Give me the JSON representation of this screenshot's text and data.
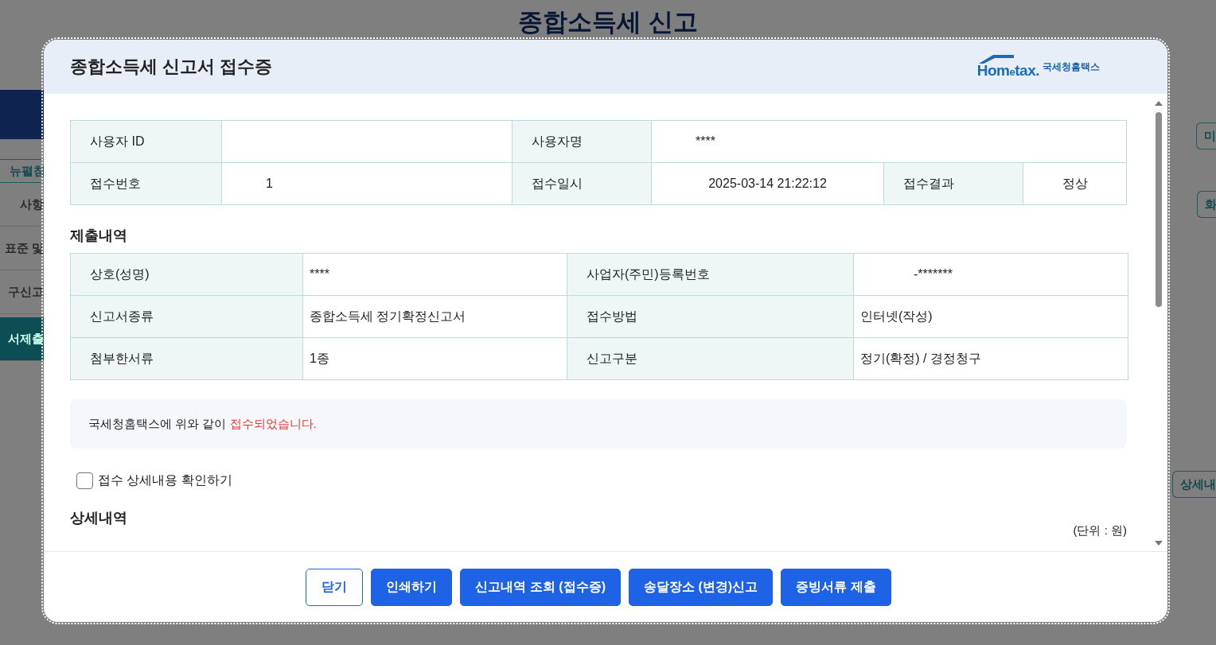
{
  "background_page": {
    "title": "종합소득세 신고",
    "menu_toggle": "뉴펼침",
    "sidebar": [
      {
        "label": "사항",
        "selected": false
      },
      {
        "label": "표준 및",
        "selected": false
      },
      {
        "label": "구신고",
        "selected": false
      },
      {
        "label": "서제출",
        "selected": true
      }
    ],
    "right_buttons": [
      "미",
      "화",
      "상세내"
    ]
  },
  "dialog": {
    "title": "종합소득세 신고서 접수증",
    "logo": {
      "wordmark": "Hom$_{e}$tax.",
      "name": "국세청홈택스"
    },
    "info_table": {
      "rows": [
        [
          {
            "kind": "label",
            "text": "사용자 ID"
          },
          {
            "kind": "value"
          },
          {
            "kind": "label",
            "text": "사용자명"
          },
          {
            "kind": "value",
            "text": "****"
          }
        ],
        [
          {
            "kind": "label",
            "text": "접수번호"
          },
          {
            "kind": "value",
            "text": "1"
          },
          {
            "kind": "label",
            "text": "접수일시"
          },
          {
            "kind": "value",
            "text": "2025-03-14 21:22:12"
          },
          {
            "kind": "label",
            "text": "접수결과"
          },
          {
            "kind": "value",
            "text": "정상"
          }
        ]
      ]
    },
    "submission_heading": "제출내역",
    "submission_table": {
      "rows": [
        [
          {
            "kind": "label",
            "text": "상호(성명)"
          },
          {
            "kind": "value",
            "text": "****"
          },
          {
            "kind": "label",
            "text": "사업자(주민)등록번호"
          },
          {
            "kind": "value",
            "text": "-*******"
          }
        ],
        [
          {
            "kind": "label",
            "text": "신고서종류"
          },
          {
            "kind": "value",
            "text": "종합소득세 정기확정신고서"
          },
          {
            "kind": "label",
            "text": "접수방법"
          },
          {
            "kind": "value",
            "text": "인터넷(작성)"
          }
        ],
        [
          {
            "kind": "label",
            "text": "첨부한서류"
          },
          {
            "kind": "value",
            "text": "1종"
          },
          {
            "kind": "label",
            "text": "신고구분"
          },
          {
            "kind": "value",
            "text": "정기(확정) / 경정청구"
          }
        ]
      ]
    },
    "notice": {
      "text": "국세청홈택스에 위와 같이 ",
      "highlight": "접수되었습니다."
    },
    "detail_checkbox": {
      "label": "접수 상세내용 확인하기",
      "checked": false
    },
    "detail_heading": "상세내역",
    "unit": "(단위 : 원)",
    "buttons": [
      {
        "label": "닫기",
        "kind": "outline"
      },
      {
        "label": "인쇄하기",
        "kind": "primary"
      },
      {
        "label": "신고내역 조회 (접수증)",
        "kind": "primary"
      },
      {
        "label": "송달장소 (변경)신고",
        "kind": "primary"
      },
      {
        "label": "증빙서류 제출",
        "kind": "primary"
      }
    ]
  }
}
